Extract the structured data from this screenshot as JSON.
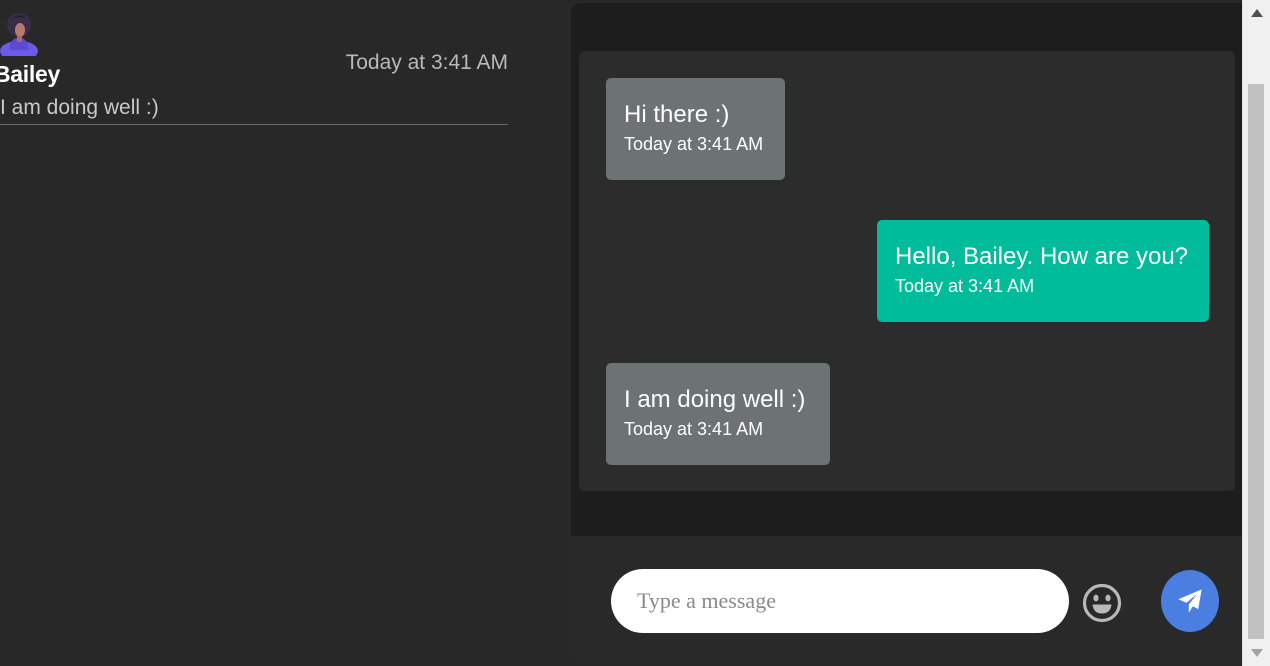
{
  "conversations": [
    {
      "name": "Bailey",
      "time": "Today at 3:41 AM",
      "preview": "I am doing well :)",
      "avatar_icon": "user-avatar-icon"
    }
  ],
  "chat": {
    "messages": [
      {
        "direction": "incoming",
        "text": "Hi there :)",
        "time": "Today at 3:41 AM"
      },
      {
        "direction": "outgoing",
        "text": "Hello, Bailey. How are you?",
        "time": "Today at 3:41 AM"
      },
      {
        "direction": "incoming",
        "text": "I am doing well :)",
        "time": "Today at 3:41 AM"
      }
    ],
    "composer": {
      "placeholder": "Type a message",
      "value": "",
      "emoji_icon": "smiley-icon",
      "send_icon": "paper-plane-icon"
    }
  },
  "colors": {
    "background": "#282828",
    "chat_panel": "#1d1d1d",
    "incoming_bubble": "#6c7372",
    "outgoing_bubble": "#00bc9a",
    "send_button": "#4a7ee0"
  }
}
